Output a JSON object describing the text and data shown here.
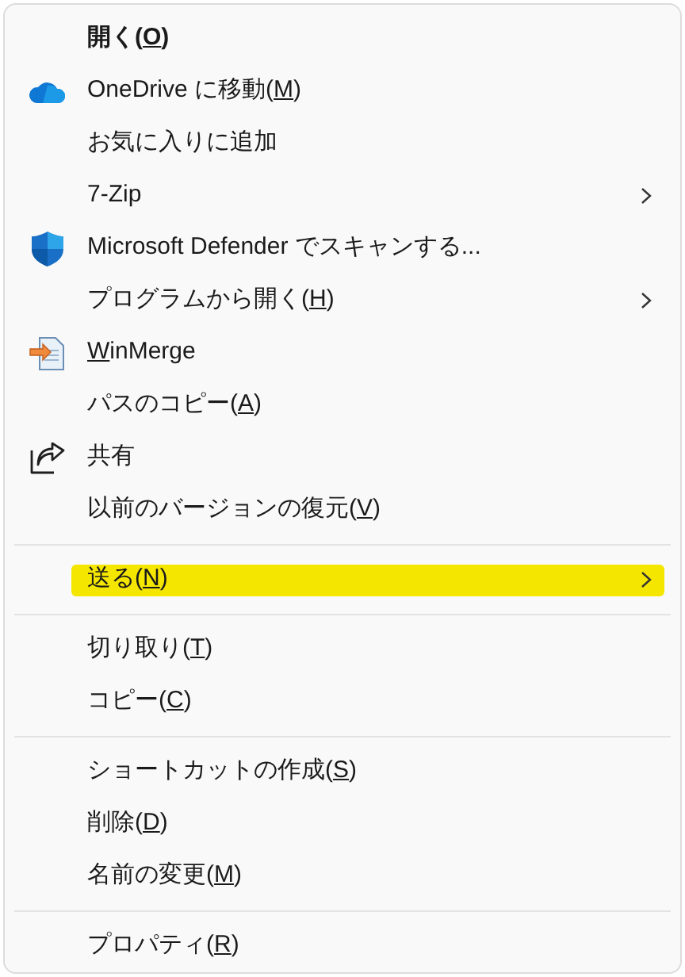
{
  "menu": {
    "items": [
      {
        "kind": "item",
        "label": {
          "before": "開く(",
          "key": "O",
          "after": ")"
        },
        "bold": true,
        "submenu": false,
        "highlighted": false
      },
      {
        "kind": "item",
        "label": {
          "before": "OneDrive に移動(",
          "key": "M",
          "after": ")"
        },
        "bold": false,
        "submenu": false,
        "highlighted": false
      },
      {
        "kind": "item",
        "label": {
          "before": "お気に入りに追加"
        },
        "bold": false,
        "submenu": false,
        "highlighted": false
      },
      {
        "kind": "item",
        "label": {
          "before": "7-Zip"
        },
        "bold": false,
        "submenu": true,
        "highlighted": false
      },
      {
        "kind": "item",
        "label": {
          "before": "Microsoft Defender でスキャンする..."
        },
        "bold": false,
        "submenu": false,
        "highlighted": false
      },
      {
        "kind": "item",
        "label": {
          "before": "プログラムから開く(",
          "key": "H",
          "after": ")"
        },
        "bold": false,
        "submenu": true,
        "highlighted": false
      },
      {
        "kind": "item",
        "label": {
          "key": "W",
          "after": "inMerge"
        },
        "bold": false,
        "submenu": false,
        "highlighted": false
      },
      {
        "kind": "item",
        "label": {
          "before": "パスのコピー(",
          "key": "A",
          "after": ")"
        },
        "bold": false,
        "submenu": false,
        "highlighted": false
      },
      {
        "kind": "item",
        "label": {
          "before": "共有"
        },
        "bold": false,
        "submenu": false,
        "highlighted": false
      },
      {
        "kind": "item",
        "label": {
          "before": "以前のバージョンの復元(",
          "key": "V",
          "after": ")"
        },
        "bold": false,
        "submenu": false,
        "highlighted": false
      },
      {
        "kind": "separator"
      },
      {
        "kind": "item",
        "label": {
          "before": "送る(",
          "key": "N",
          "after": ")"
        },
        "bold": false,
        "submenu": true,
        "highlighted": true
      },
      {
        "kind": "separator"
      },
      {
        "kind": "item",
        "label": {
          "before": "切り取り(",
          "key": "T",
          "after": ")"
        },
        "bold": false,
        "submenu": false,
        "highlighted": false
      },
      {
        "kind": "item",
        "label": {
          "before": "コピー(",
          "key": "C",
          "after": ")"
        },
        "bold": false,
        "submenu": false,
        "highlighted": false
      },
      {
        "kind": "separator"
      },
      {
        "kind": "item",
        "label": {
          "before": "ショートカットの作成(",
          "key": "S",
          "after": ")"
        },
        "bold": false,
        "submenu": false,
        "highlighted": false
      },
      {
        "kind": "item",
        "label": {
          "before": "削除(",
          "key": "D",
          "after": ")"
        },
        "bold": false,
        "submenu": false,
        "highlighted": false
      },
      {
        "kind": "item",
        "label": {
          "before": "名前の変更(",
          "key": "M",
          "after": ")"
        },
        "bold": false,
        "submenu": false,
        "highlighted": false
      },
      {
        "kind": "separator"
      },
      {
        "kind": "item",
        "label": {
          "before": "プロパティ(",
          "key": "R",
          "after": ")"
        },
        "bold": false,
        "submenu": false,
        "highlighted": false
      }
    ]
  }
}
